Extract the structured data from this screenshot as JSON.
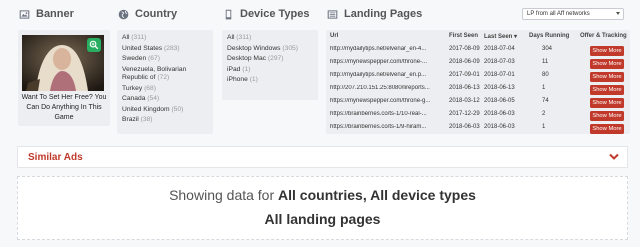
{
  "banner": {
    "title": "Banner",
    "icon": "image-icon",
    "ad_text": "Want To Set Her Free? You Can Do Anything In This Game"
  },
  "country": {
    "title": "Country",
    "icon": "globe-icon",
    "items": [
      {
        "label": "All",
        "count": "(311)"
      },
      {
        "label": "United States",
        "count": "(283)"
      },
      {
        "label": "Sweden",
        "count": "(67)"
      },
      {
        "label": "Venezuela, Bolivarian Republic of",
        "count": "(72)"
      },
      {
        "label": "Turkey",
        "count": "(68)"
      },
      {
        "label": "Canada",
        "count": "(54)"
      },
      {
        "label": "United Kingdom",
        "count": "(50)"
      },
      {
        "label": "Brazil",
        "count": "(38)"
      }
    ]
  },
  "device": {
    "title": "Device Types",
    "icon": "mobile-icon",
    "items": [
      {
        "label": "All",
        "count": "(311)"
      },
      {
        "label": "Desktop Windows",
        "count": "(305)"
      },
      {
        "label": "Desktop Mac",
        "count": "(297)"
      },
      {
        "label": "iPad",
        "count": "(1)"
      },
      {
        "label": "iPhone",
        "count": "(1)"
      }
    ]
  },
  "landing": {
    "title": "Landing Pages",
    "icon": "list-icon",
    "network_select": "LP from all Aff networks",
    "headers": {
      "url": "Url",
      "first_seen": "First Seen",
      "last_seen": "Last Seen",
      "sort_mark": "▾",
      "days": "Days Running",
      "offer": "Offer & Tracking"
    },
    "button_label": "Show More",
    "rows": [
      {
        "url": "http://mydailytips.net/elvenar_en-4...",
        "first": "2017-08-09",
        "last": "2018-07-04",
        "days": "304"
      },
      {
        "url": "https://mynewspepper.com/throne-...",
        "first": "2018-06-09",
        "last": "2018-07-03",
        "days": "11"
      },
      {
        "url": "http://mydailytips.net/elvenar_en.p...",
        "first": "2017-09-01",
        "last": "2018-07-01",
        "days": "80"
      },
      {
        "url": "http://207.210.151.25:8080/lireports...",
        "first": "2018-06-13",
        "last": "2018-06-13",
        "days": "1"
      },
      {
        "url": "https://mynewspepper.com/throne-g...",
        "first": "2018-03-12",
        "last": "2018-06-05",
        "days": "74"
      },
      {
        "url": "https://brainberries.co/ts-1/10-real-...",
        "first": "2017-12-29",
        "last": "2018-06-03",
        "days": "2"
      },
      {
        "url": "https://brainberries.co/ts-1/9-hiram...",
        "first": "2018-06-03",
        "last": "2018-06-03",
        "days": "1"
      }
    ]
  },
  "similar_ads": {
    "title": "Similar Ads",
    "icon": "chevron-down-icon"
  },
  "summary": {
    "prefix": "Showing data for ",
    "bold": "All countries, All device types",
    "line2": "All landing pages"
  },
  "colors": {
    "accent_red": "#c0392b",
    "zoom_green": "#27ae60"
  }
}
